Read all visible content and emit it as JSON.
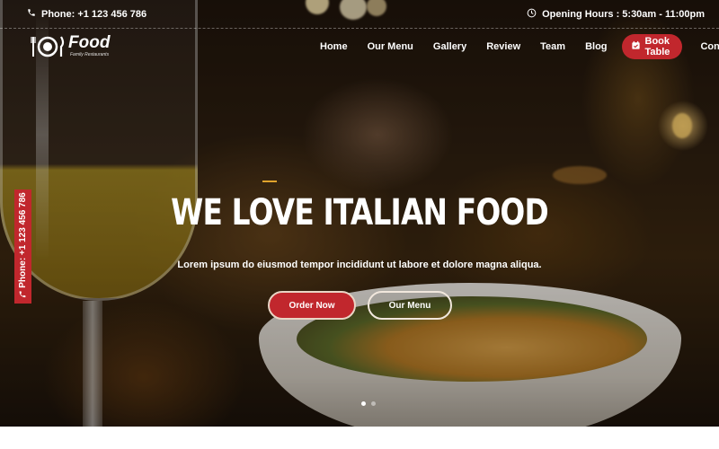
{
  "topbar": {
    "phone": "Phone: +1 123 456 786",
    "hours": "Opening Hours : 5:30am - 11:00pm"
  },
  "brand": {
    "name": "Food",
    "tagline": "Family Restaurants"
  },
  "nav": {
    "items": [
      "Home",
      "Our Menu",
      "Gallery",
      "Review",
      "Team",
      "Blog"
    ],
    "book_label": "Book Table",
    "contact_label": "Contact"
  },
  "hero": {
    "title": "WE LOVE ITALIAN FOOD",
    "subtitle": "Lorem ipsum do eiusmod tempor incididunt ut labore et dolore magna aliqua.",
    "order_label": "Order Now",
    "menu_label": "Our Menu"
  },
  "side_tab": {
    "phone": "Phone: +1 123 456 786"
  },
  "slider": {
    "slides": 2,
    "active": 1
  },
  "colors": {
    "accent": "#c1272d",
    "divider": "#e0a32c"
  }
}
